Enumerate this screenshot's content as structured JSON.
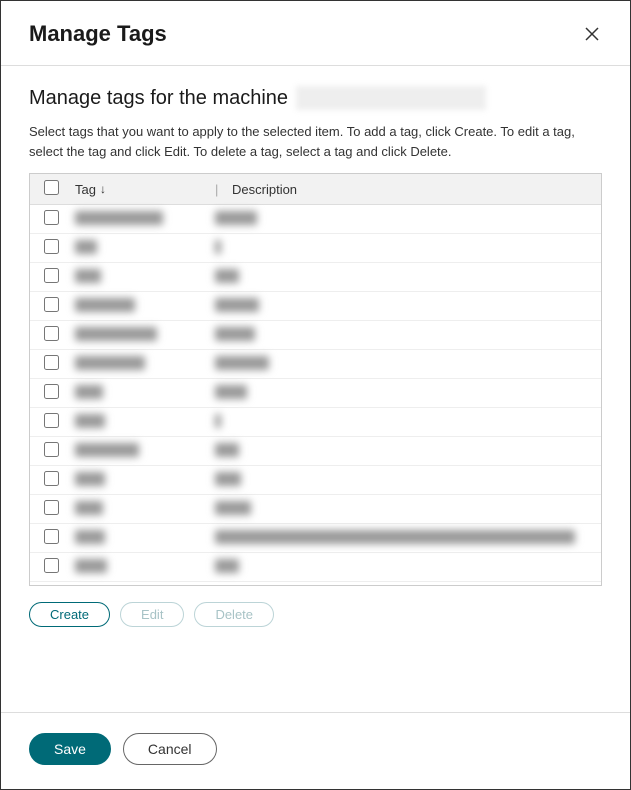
{
  "dialog": {
    "title": "Manage Tags",
    "subtitle_prefix": "Manage tags for the machine",
    "machine_name": "",
    "description": "Select tags that you want to apply to the selected item. To add a tag, click Create. To edit a tag, select the tag and click Edit. To delete a tag, select a tag and click Delete."
  },
  "table": {
    "headers": {
      "tag": "Tag",
      "description": "Description"
    },
    "rows": [
      {
        "tag_width": 88,
        "desc_width": 42
      },
      {
        "tag_width": 22,
        "desc_width": 6
      },
      {
        "tag_width": 26,
        "desc_width": 24
      },
      {
        "tag_width": 60,
        "desc_width": 44
      },
      {
        "tag_width": 82,
        "desc_width": 40
      },
      {
        "tag_width": 70,
        "desc_width": 54
      },
      {
        "tag_width": 28,
        "desc_width": 32
      },
      {
        "tag_width": 30,
        "desc_width": 6
      },
      {
        "tag_width": 64,
        "desc_width": 24
      },
      {
        "tag_width": 30,
        "desc_width": 26
      },
      {
        "tag_width": 28,
        "desc_width": 36
      },
      {
        "tag_width": 30,
        "desc_width": 360
      },
      {
        "tag_width": 32,
        "desc_width": 24
      }
    ]
  },
  "actions": {
    "create": "Create",
    "edit": "Edit",
    "delete": "Delete"
  },
  "footer": {
    "save": "Save",
    "cancel": "Cancel"
  }
}
